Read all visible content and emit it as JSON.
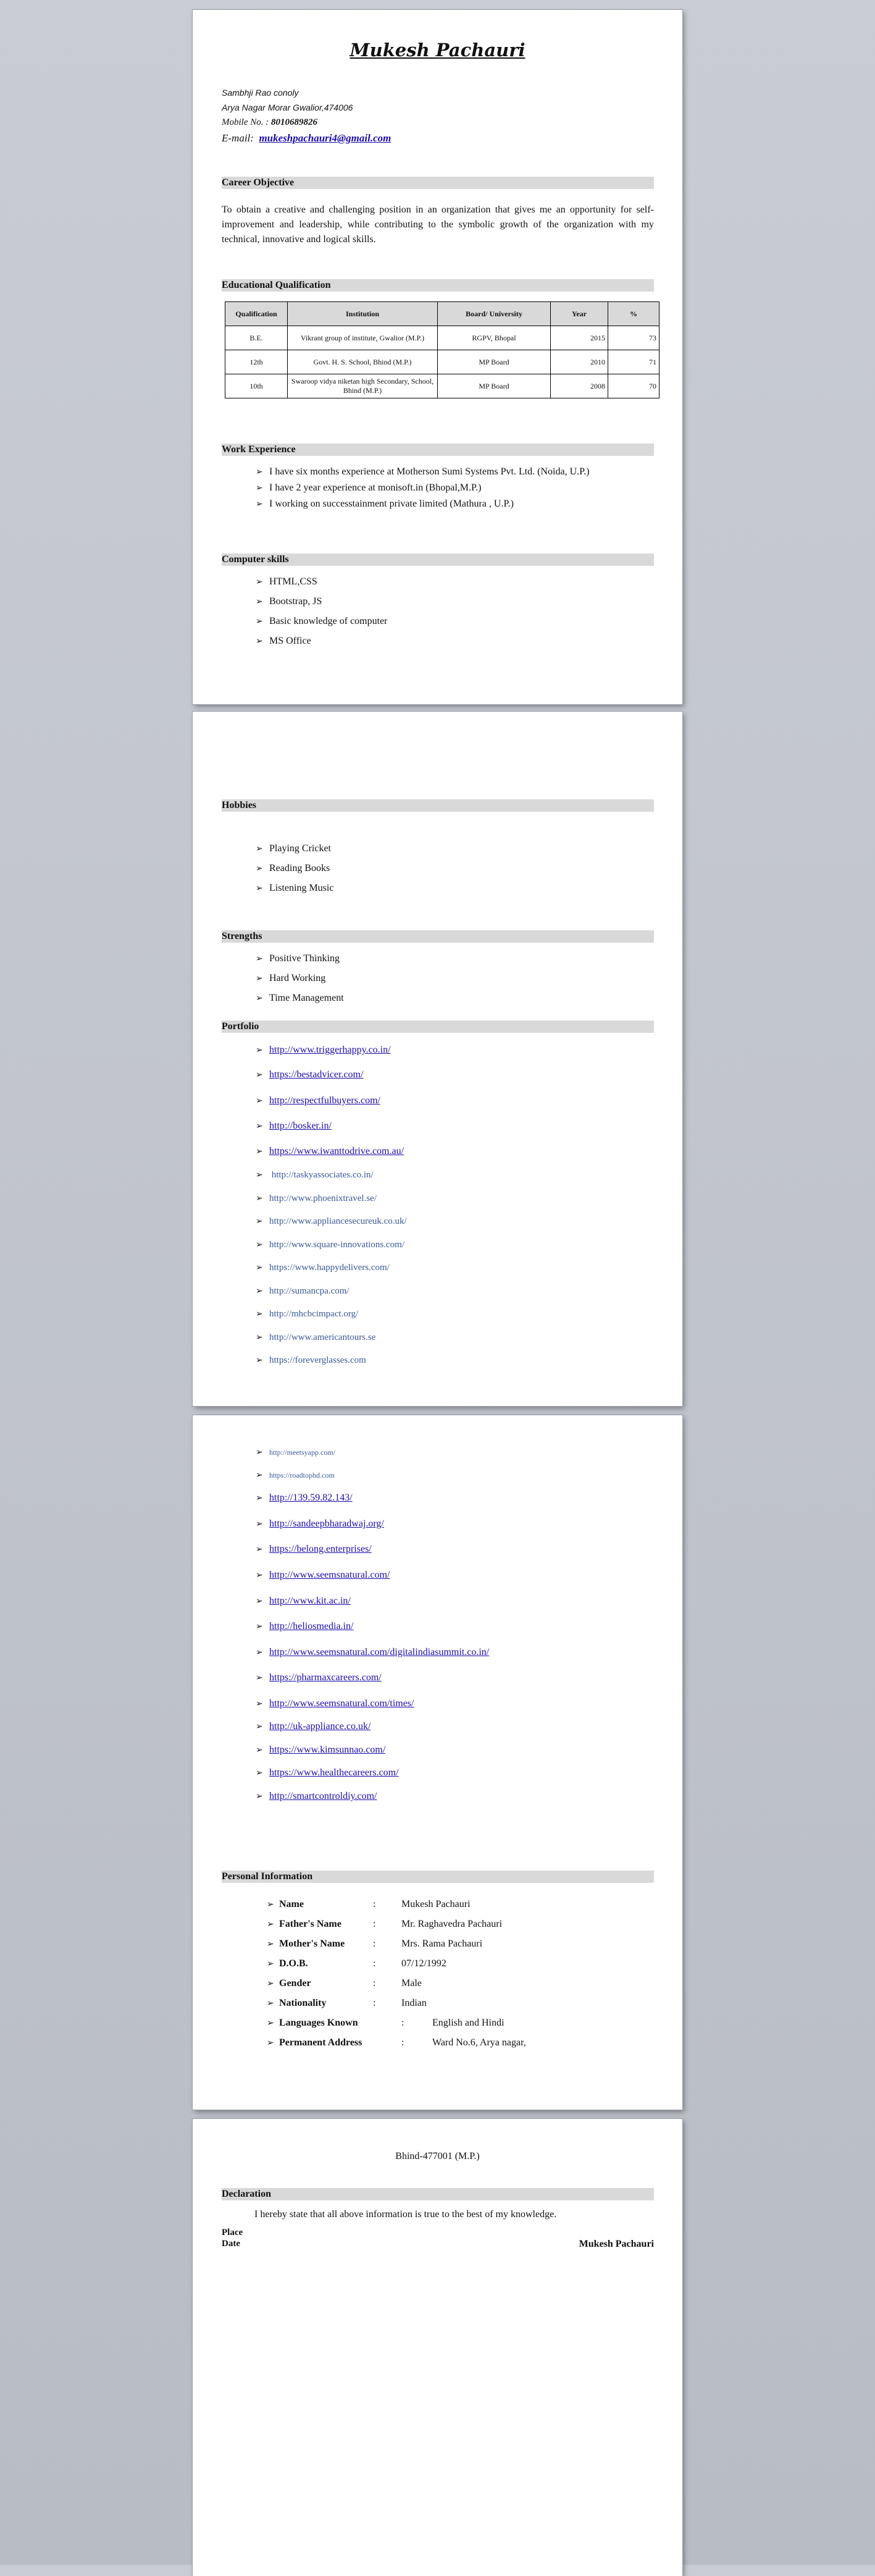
{
  "header": {
    "name": "Mukesh Pachauri",
    "address1": "Sambhji Rao conoly",
    "address2": "Arya Nagar Morar Gwalior,474006",
    "mobile_label": "Mobile No. :",
    "mobile": "8010689826",
    "email_label": "E-mail:",
    "email": "mukeshpachauri4@gmail.com"
  },
  "career": {
    "title": "Career Objective",
    "text": "To obtain a creative and challenging position in an organization that gives me an opportunity for self-improvement and leadership, while contributing to the symbolic growth of the organization with my technical, innovative and logical skills."
  },
  "education": {
    "title": "Educational Qualification",
    "headers": [
      "Qualification",
      "Institution",
      "Board/ University",
      "Year",
      "%"
    ],
    "rows": [
      [
        "B.E.",
        "Vikrant group of institute, Gwalior (M.P.)",
        "RGPV, Bhopal",
        "2015",
        "73"
      ],
      [
        "12th",
        "Govt. H. S. School, Bhind (M.P.)",
        "MP Board",
        "2010",
        "71"
      ],
      [
        "10th",
        "Swaroop vidya niketan high Secondary, School, Bhind (M.P.)",
        "MP Board",
        "2008",
        "70"
      ]
    ]
  },
  "work": {
    "title": "Work Experience",
    "items": [
      "I have six months experience at Motherson Sumi Systems Pvt. Ltd. (Noida, U.P.)",
      "I have 2 year experience at monisoft.in (Bhopal,M.P.)",
      "I working on successtainment private limited (Mathura , U.P.)"
    ]
  },
  "skills": {
    "title": "Computer skills",
    "items": [
      "HTML,CSS",
      "Bootstrap, JS",
      "Basic knowledge of computer",
      "MS Office"
    ]
  },
  "hobbies": {
    "title": "Hobbies",
    "items": [
      "Playing Cricket",
      "Reading Books",
      "Listening Music"
    ]
  },
  "strengths": {
    "title": "Strengths",
    "items": [
      "Positive Thinking",
      "Hard Working",
      "Time Management"
    ]
  },
  "portfolio": {
    "title": "Portfolio",
    "links1": [
      "http://www.triggerhappy.co.in/",
      "https://bestadvicer.com/",
      "http://respectfulbuyers.com/",
      "http://bosker.in/",
      "https://www.iwanttodrive.com.au/",
      "http://taskyassociates.co.in/",
      "http://www.phoenixtravel.se/",
      "http://www.appliancesecureuk.co.uk/",
      "http://www.square-innovations.com/",
      "https://www.happydelivers.com/",
      "http://sumancpa.com/",
      "http://mhcbcimpact.org/",
      "http://www.americantours.se",
      "https://foreverglasses.com"
    ],
    "links2": [
      "http://meetsyapp.com/",
      "https://roadtophd.com",
      "http://139.59.82.143/",
      "http://sandeepbharadwaj.org/",
      "https://belong.enterprises/",
      "http://www.seemsnatural.com/",
      "http://www.kit.ac.in/",
      "http://heliosmedia.in/",
      "http://www.seemsnatural.com/digitalindiasummit.co.in/",
      "https://pharmaxcareers.com/",
      "http://www.seemsnatural.com/times/",
      "http://uk-appliance.co.uk/",
      "https://www.kimsunnao.com/",
      "https://www.healthecareers.com/",
      "http://smartcontroldiy.com/"
    ]
  },
  "personal": {
    "title": "Personal Information",
    "rows": [
      {
        "k": "Name",
        "v": "Mukesh Pachauri"
      },
      {
        "k": "Father's Name",
        "v": "Mr. Raghavedra Pachauri"
      },
      {
        "k": "Mother's Name",
        "v": "Mrs. Rama Pachauri"
      },
      {
        "k": "D.O.B.",
        "v": "07/12/1992"
      },
      {
        "k": "Gender",
        "v": "Male"
      },
      {
        "k": "Nationality",
        "v": "Indian"
      },
      {
        "k": "Languages Known",
        "v": "English and Hindi"
      },
      {
        "k": "Permanent Address",
        "v": "Ward No.6, Arya nagar,"
      }
    ]
  },
  "address_cont": "Bhind-477001 (M.P.)",
  "declaration": {
    "title": "Declaration",
    "text": "I hereby state that all above information is true to the best of my knowledge.",
    "place": "Place",
    "date": "Date",
    "signature": "Mukesh Pachauri"
  },
  "colon": ":"
}
